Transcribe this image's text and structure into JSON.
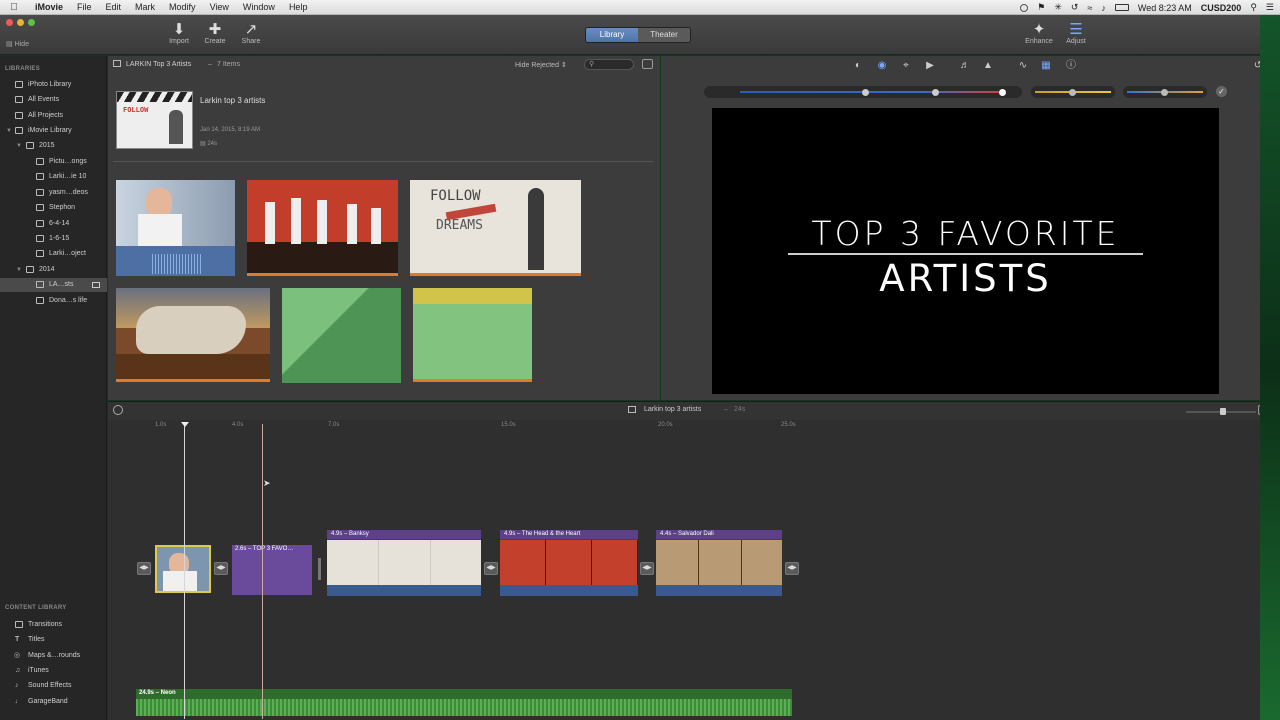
{
  "menubar": {
    "app": "iMovie",
    "items": [
      "File",
      "Edit",
      "Mark",
      "Modify",
      "View",
      "Window",
      "Help"
    ],
    "clock": "Wed 8:23 AM",
    "user": "CUSD200"
  },
  "toolbar": {
    "hide": "Hide",
    "import": "Import",
    "create": "Create",
    "share": "Share",
    "library_tab": "Library",
    "theater_tab": "Theater",
    "enhance": "Enhance",
    "adjust": "Adjust"
  },
  "sidebar": {
    "libraries_header": "LIBRARIES",
    "items": [
      {
        "label": "iPhoto Library"
      },
      {
        "label": "All Events"
      },
      {
        "label": "All Projects"
      },
      {
        "label": "iMovie Library"
      },
      {
        "label": "2015"
      },
      {
        "label": "Pictu…ongs"
      },
      {
        "label": "Larki…ie 10"
      },
      {
        "label": "yasm…deos"
      },
      {
        "label": "Stephon"
      },
      {
        "label": "6-4-14"
      },
      {
        "label": "1-6-15"
      },
      {
        "label": "Larki…oject"
      },
      {
        "label": "2014"
      },
      {
        "label": "LA…sts"
      },
      {
        "label": "Dona…s life"
      }
    ],
    "content_header": "CONTENT LIBRARY",
    "content_items": [
      {
        "label": "Transitions"
      },
      {
        "label": "Titles"
      },
      {
        "label": "Maps &…rounds"
      },
      {
        "label": "iTunes"
      },
      {
        "label": "Sound Effects"
      },
      {
        "label": "GarageBand"
      }
    ]
  },
  "browser": {
    "header_title": "LARKIN Top 3 Artists",
    "header_count": "7 Items",
    "hide_rejected": "Hide Rejected",
    "event_title": "Larkin top 3 artists",
    "event_date": "Jan 14, 2015, 8:19 AM",
    "event_duration": "24s"
  },
  "viewer": {
    "title_line1": "TOP 3 FAVORITE",
    "title_line2": "ARTISTS"
  },
  "timeline": {
    "project_title": "Larkin top 3 artists",
    "project_duration": "24s",
    "ruler": [
      "1.0s",
      "4.0s",
      "7.0s",
      "15.0s",
      "20.0s",
      "25.0s"
    ],
    "clips": [
      {
        "label": "2.6s – TOP 3 FAVO…"
      },
      {
        "label": "4.9s – Banksy"
      },
      {
        "label": "4.9s – The  Head & the Heart"
      },
      {
        "label": "4.4s – Salvador Dali"
      }
    ],
    "audio_label": "24.9s – Neon"
  },
  "colors": {
    "accent": "#5b82c2",
    "title_clip": "#6a4a9a",
    "audio": "#4c9a44",
    "selection": "#e0c84a"
  }
}
